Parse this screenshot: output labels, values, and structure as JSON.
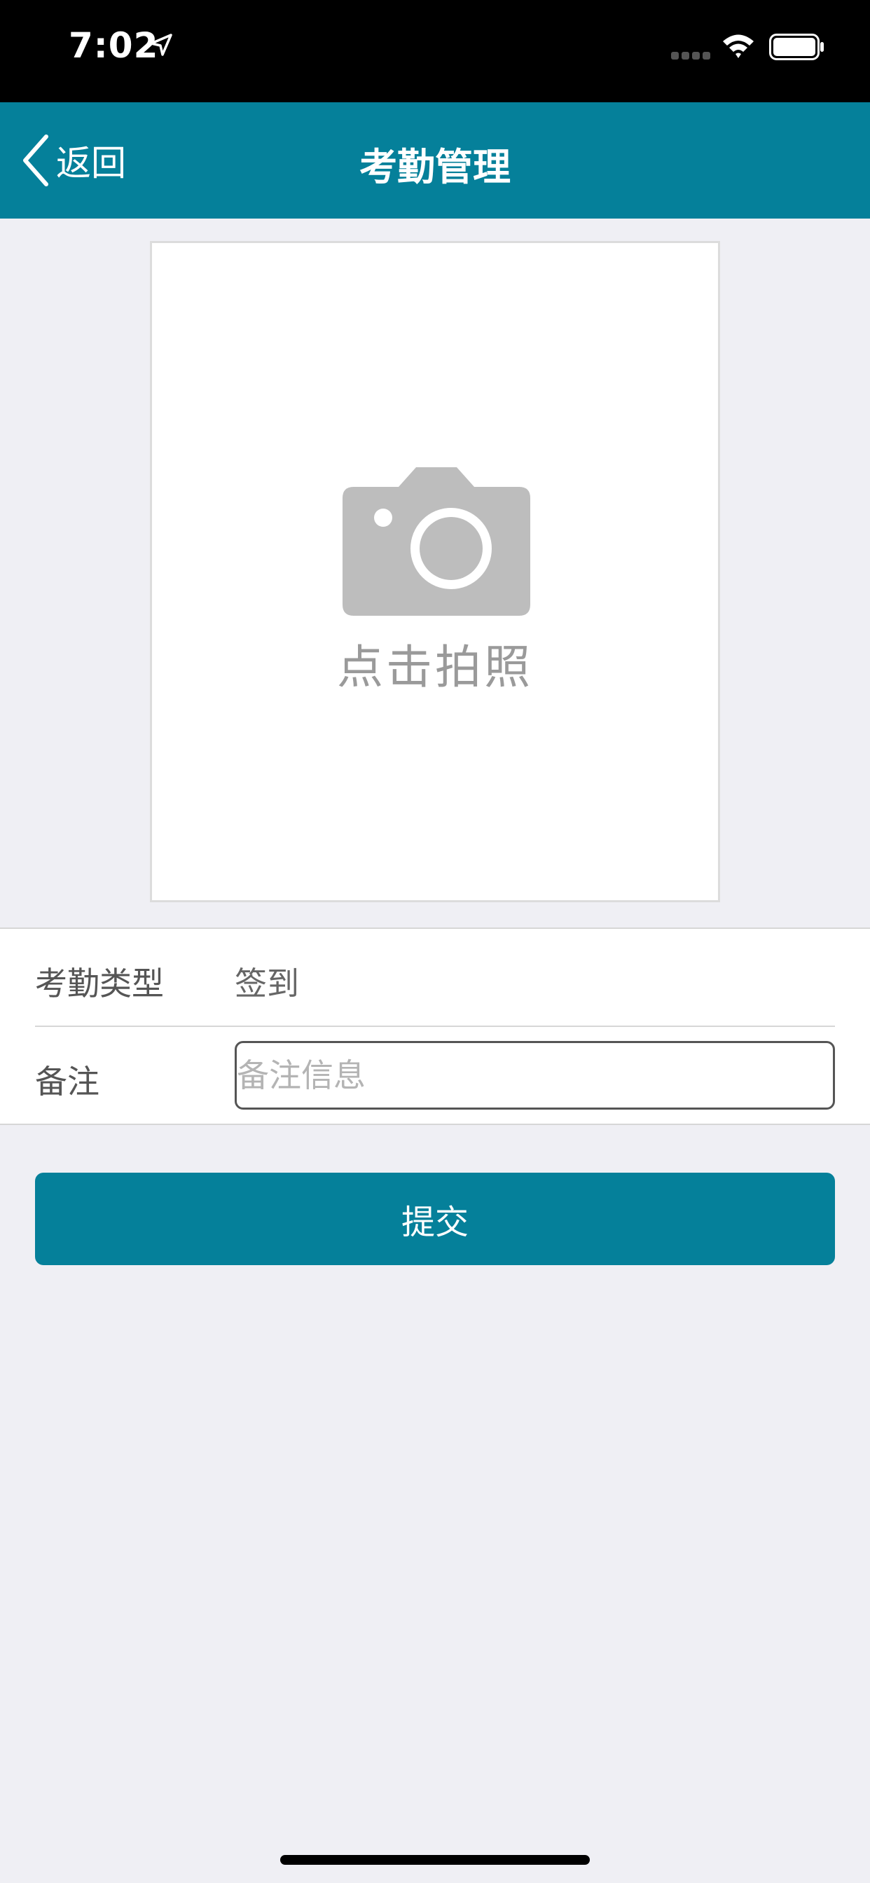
{
  "status_bar": {
    "time": "7:02",
    "icons": [
      "location-arrow-icon",
      "signal-icon",
      "wifi-icon",
      "battery-icon"
    ]
  },
  "nav": {
    "back_label": "返回",
    "title": "考勤管理",
    "background_color": "#05809a"
  },
  "photo": {
    "label": "点击拍照",
    "icon": "camera-icon"
  },
  "form": {
    "type_label": "考勤类型",
    "type_value": "签到",
    "remark_label": "备注",
    "remark_value": "",
    "remark_placeholder": "备注信息"
  },
  "submit": {
    "label": "提交",
    "color": "#05809a"
  }
}
